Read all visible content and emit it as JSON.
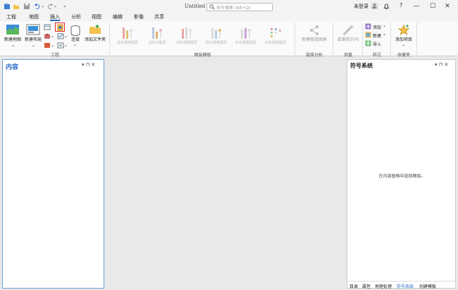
{
  "window": {
    "title": "Untitled",
    "search_placeholder": "命令搜索 (Alt+Q)",
    "user_label": "未登录",
    "minimize": "—",
    "maximize": "☐",
    "close": "✕"
  },
  "tabs": [
    "工程",
    "地图",
    "插入",
    "分析",
    "视图",
    "编辑",
    "影像",
    "共享"
  ],
  "active_tab": "插入",
  "ribbon": {
    "project": {
      "new_map": "新建地图",
      "new_layout": "新建布局",
      "connect": "连接",
      "add_folder": "添加文件夹",
      "group_label": "工程"
    },
    "layer_templates": {
      "items": [
        "底色栅格图层",
        "浅色点图层",
        "浅色栅格图层",
        "配对栅格图层",
        "彩色栅格图层",
        "彩色栅格图层"
      ],
      "group_label": "图层模板"
    },
    "link_analysis": {
      "button": "新建链接图表",
      "group_label": "链接分析"
    },
    "measure": {
      "button": "距离和方向",
      "group_label": "测量"
    },
    "styles": {
      "add": "添加",
      "new": "新建",
      "import": "导入",
      "group_label": "样式"
    },
    "favorites": {
      "button": "添加项目",
      "group_label": "收藏夹"
    }
  },
  "left_pane": {
    "title": "内容",
    "pin": "▾  ⊓  ✕"
  },
  "right_pane": {
    "title": "符号系统",
    "pin": "▾  ⊓  ✕",
    "message": "在内容窗格中选择图层。",
    "tabs": [
      "目录",
      "属性",
      "地理处理",
      "符号系统",
      "创建模板"
    ],
    "active_tab": "符号系统"
  }
}
